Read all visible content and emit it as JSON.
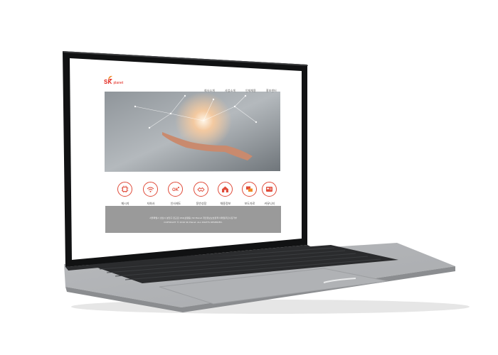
{
  "brand": {
    "logo_text": "SK",
    "logo_sub": "planet",
    "color": "#e2231a"
  },
  "nav": [
    {
      "label": "회사소개"
    },
    {
      "label": "사업소개"
    },
    {
      "label": "인재채용"
    },
    {
      "label": "홍보센터"
    }
  ],
  "quick_links": [
    {
      "label": "메시지",
      "icon": "chip-icon"
    },
    {
      "label": "지회사",
      "icon": "wifi-icon"
    },
    {
      "label": "인사제도",
      "icon": "ok-icon"
    },
    {
      "label": "동반성장",
      "icon": "handshake-icon"
    },
    {
      "label": "채용정보",
      "icon": "home-icon"
    },
    {
      "label": "보도자료",
      "icon": "speech-icon"
    },
    {
      "label": "커뮤니티",
      "icon": "card-icon"
    }
  ],
  "footer": {
    "line1": "서울특별시 성남시 분당구 판교로 264(삼평동) SK Planet 개인정보보호정책 이메일무단수집거부",
    "line2": "COPYRIGHT © 2016 SK Planet. ALL RIGHTS RESERVED."
  },
  "colors": {
    "accent": "#e04b3a",
    "footer_bg": "#9a9a9a",
    "laptop_body": "#c9cbcd",
    "bezel": "#0f0f10"
  }
}
